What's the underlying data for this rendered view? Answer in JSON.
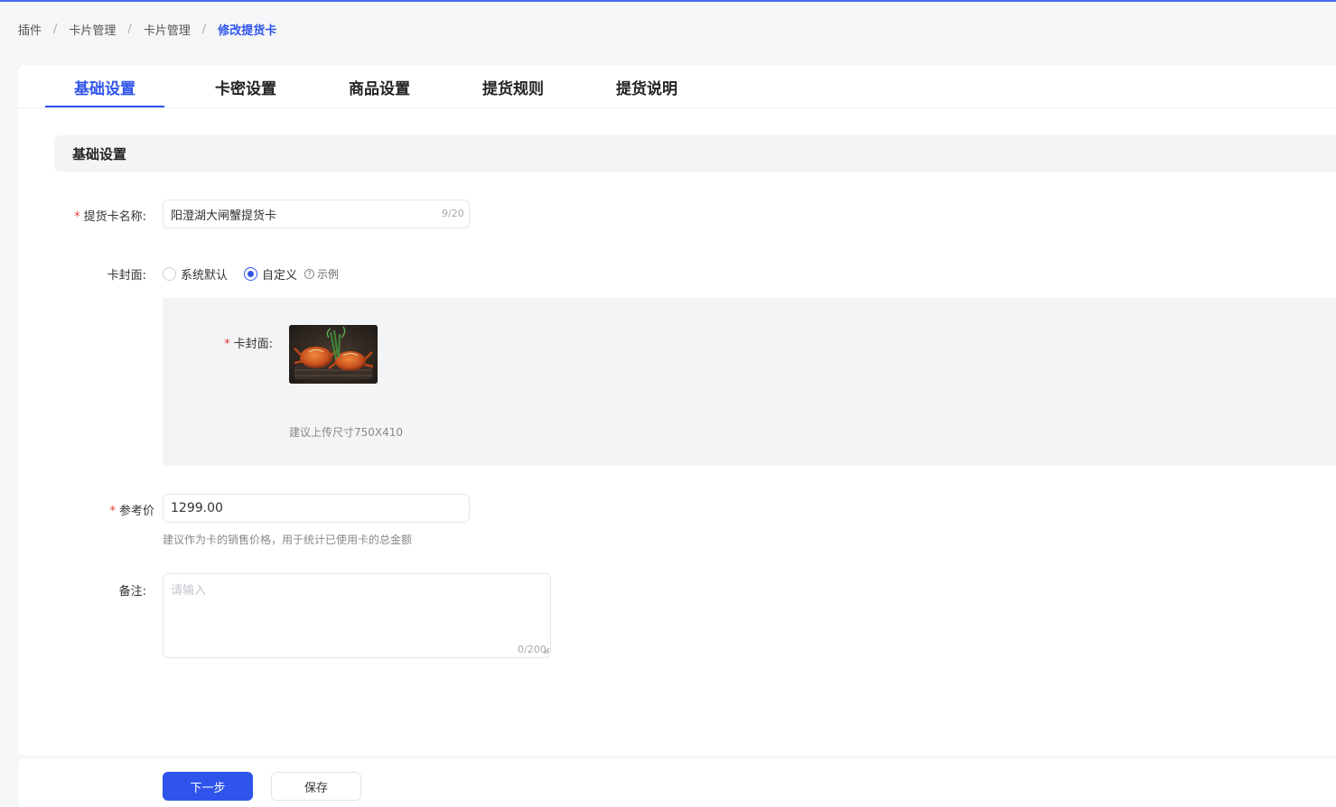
{
  "breadcrumb": {
    "items": [
      "插件",
      "卡片管理",
      "卡片管理",
      "修改提货卡"
    ],
    "separator": "/"
  },
  "tabs": [
    {
      "label": "基础设置",
      "active": true
    },
    {
      "label": "卡密设置",
      "active": false
    },
    {
      "label": "商品设置",
      "active": false
    },
    {
      "label": "提货规则",
      "active": false
    },
    {
      "label": "提货说明",
      "active": false
    }
  ],
  "section": {
    "title": "基础设置"
  },
  "form": {
    "required_mark": "*",
    "name": {
      "label": "提货卡名称:",
      "value": "阳澄湖大闸蟹提货卡",
      "counter": "9/20"
    },
    "cover_type": {
      "label": "卡封面:",
      "options": [
        {
          "label": "系统默认",
          "checked": false
        },
        {
          "label": "自定义",
          "checked": true
        }
      ],
      "example_label": "示例",
      "example_icon": "question-circle-icon"
    },
    "cover": {
      "label": "卡封面:",
      "hint": "建议上传尺寸750X410"
    },
    "price": {
      "label": "参考价",
      "value": "1299.00",
      "help": "建议作为卡的销售价格，用于统计已使用卡的总金额"
    },
    "remark": {
      "label": "备注:",
      "placeholder": "请输入",
      "counter": "0/200"
    }
  },
  "footer": {
    "next_label": "下一步",
    "save_label": "保存"
  },
  "colors": {
    "primary": "#2f54eb",
    "required": "#e53935",
    "panel_bg": "#f3f4f6"
  }
}
